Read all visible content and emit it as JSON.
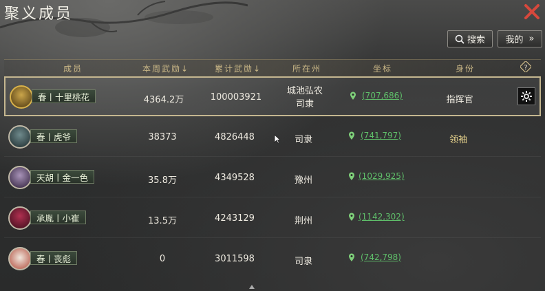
{
  "window": {
    "title": "聚义成员"
  },
  "toolbar": {
    "search_label": "搜索",
    "mine_label": "我的",
    "mine_suffix": "»"
  },
  "columns": [
    "成员",
    "本周武勋",
    "累计武勋",
    "所在州",
    "坐标",
    "身份"
  ],
  "column_sort_marks": {
    "weekly": "↓",
    "total": "↓"
  },
  "help_icon": "question-icon",
  "rows": [
    {
      "name": "春丨十里桃花",
      "weekly": "4364.2万",
      "total": "100003921",
      "state": "城池弘农\n司隶",
      "coord": "(707,686)",
      "role": "指挥官",
      "selected": true
    },
    {
      "name": "春丨虎爷",
      "weekly": "38373",
      "total": "4826448",
      "state": "司隶",
      "coord": "(741,797)",
      "role": "领袖",
      "selected": false
    },
    {
      "name": "天胡丨金一色",
      "weekly": "35.8万",
      "total": "4349528",
      "state": "豫州",
      "coord": "(1029,925)",
      "role": "",
      "selected": false
    },
    {
      "name": "承胤丨小崔",
      "weekly": "13.5万",
      "total": "4243129",
      "state": "荆州",
      "coord": "(1142,302)",
      "role": "",
      "selected": false
    },
    {
      "name": "春丨丧彪",
      "weekly": "0",
      "total": "3011598",
      "state": "司隶",
      "coord": "(742,798)",
      "role": "",
      "selected": false
    }
  ],
  "colors": {
    "accent_gold": "#cbb887",
    "coord_green": "#5fbf6a",
    "close_red": "#d8483c",
    "name_bg": "#2a332a"
  }
}
